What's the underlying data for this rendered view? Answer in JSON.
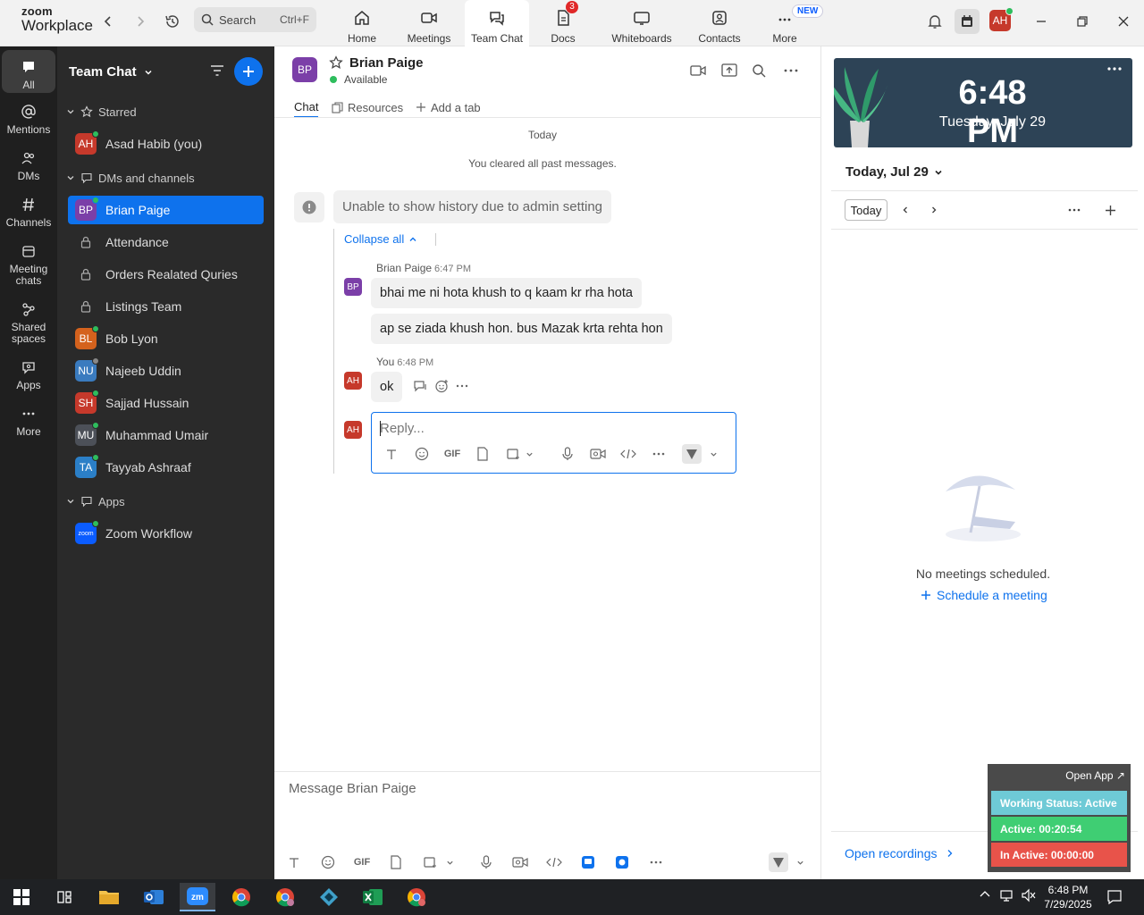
{
  "app": {
    "logo_line1": "zoom",
    "logo_line2": "Workplace"
  },
  "search": {
    "placeholder": "Search",
    "shortcut": "Ctrl+F"
  },
  "tabs": [
    {
      "label": "Home",
      "icon": "home-icon"
    },
    {
      "label": "Meetings",
      "icon": "video-camera-icon"
    },
    {
      "label": "Team Chat",
      "icon": "chat-icon"
    },
    {
      "label": "Docs",
      "icon": "document-icon",
      "badge": "3"
    },
    {
      "label": "Whiteboards",
      "icon": "whiteboard-icon"
    },
    {
      "label": "Contacts",
      "icon": "contacts-icon"
    },
    {
      "label": "More",
      "icon": "more-icon",
      "badge": "NEW"
    }
  ],
  "user": {
    "initials": "AH",
    "color": "#c6392b"
  },
  "rail": [
    {
      "label": "All"
    },
    {
      "label": "Mentions"
    },
    {
      "label": "DMs"
    },
    {
      "label": "Channels"
    },
    {
      "label": "Meeting chats"
    },
    {
      "label": "Shared spaces"
    },
    {
      "label": "Apps"
    },
    {
      "label": "More"
    }
  ],
  "sidebar": {
    "title": "Team Chat",
    "sections": {
      "starred": "Starred",
      "dms": "DMs and channels",
      "apps": "Apps"
    },
    "starred": [
      {
        "initials": "AH",
        "name": "Asad Habib (you)",
        "color": "#c6392b"
      }
    ],
    "items": [
      {
        "initials": "BP",
        "name": "Brian Paige",
        "color": "#7b3fa8",
        "type": "dm"
      },
      {
        "name": "Attendance",
        "type": "channel"
      },
      {
        "name": "Orders Realated Quries",
        "type": "channel"
      },
      {
        "name": "Listings Team",
        "type": "channel"
      },
      {
        "initials": "BL",
        "name": "Bob Lyon",
        "color": "#d4621d",
        "type": "dm"
      },
      {
        "initials": "NU",
        "name": "Najeeb Uddin",
        "color": "#3a7bbf",
        "type": "dm"
      },
      {
        "initials": "SH",
        "name": "Sajjad Hussain",
        "color": "#c6392b",
        "type": "dm"
      },
      {
        "initials": "MU",
        "name": "Muhammad Umair",
        "color": "#4c5058",
        "type": "dm"
      },
      {
        "initials": "TA",
        "name": "Tayyab Ashraaf",
        "color": "#2b7fc7",
        "type": "dm"
      }
    ],
    "apps": [
      {
        "initials": "zoom",
        "name": "Zoom Workflow",
        "color": "#0b5cff"
      }
    ]
  },
  "chat": {
    "contact_initials": "BP",
    "contact_name": "Brian Paige",
    "status": "Available",
    "tabs": [
      "Chat",
      "Resources",
      "Add a tab"
    ],
    "day_label": "Today",
    "cleared_note": "You cleared all past messages.",
    "system_message": "Unable to show history due to admin setting",
    "collapse_label": "Collapse all",
    "messages": [
      {
        "sender": "Brian Paige",
        "time": "6:47 PM",
        "initials": "BP",
        "lines": [
          "bhai me ni hota khush to q kaam kr rha hota",
          "ap se ziada khush hon. bus Mazak krta rehta hon"
        ]
      },
      {
        "sender": "You",
        "time": "6:48 PM",
        "initials": "AH",
        "lines": [
          "ok"
        ]
      }
    ],
    "reply_placeholder": "Reply...",
    "reply_gif": "GIF",
    "composer_placeholder": "Message Brian Paige",
    "composer_gif": "GIF"
  },
  "right": {
    "clock_time": "6:48 PM",
    "clock_date": "Tuesday, July 29",
    "calendar_title": "Today, Jul 29",
    "today_btn": "Today",
    "empty_text": "No meetings scheduled.",
    "schedule_link": "Schedule a meeting",
    "open_recordings": "Open recordings"
  },
  "widget": {
    "open_app": "Open App ↗",
    "working_status": "Working Status: Active",
    "active": "Active: 00:20:54",
    "inactive": "In Active: 00:00:00",
    "colors": {
      "working": "#6ecad6",
      "active": "#3fce73",
      "inactive": "#e8534a"
    }
  },
  "taskbar": {
    "time": "6:48 PM",
    "date": "7/29/2025"
  }
}
